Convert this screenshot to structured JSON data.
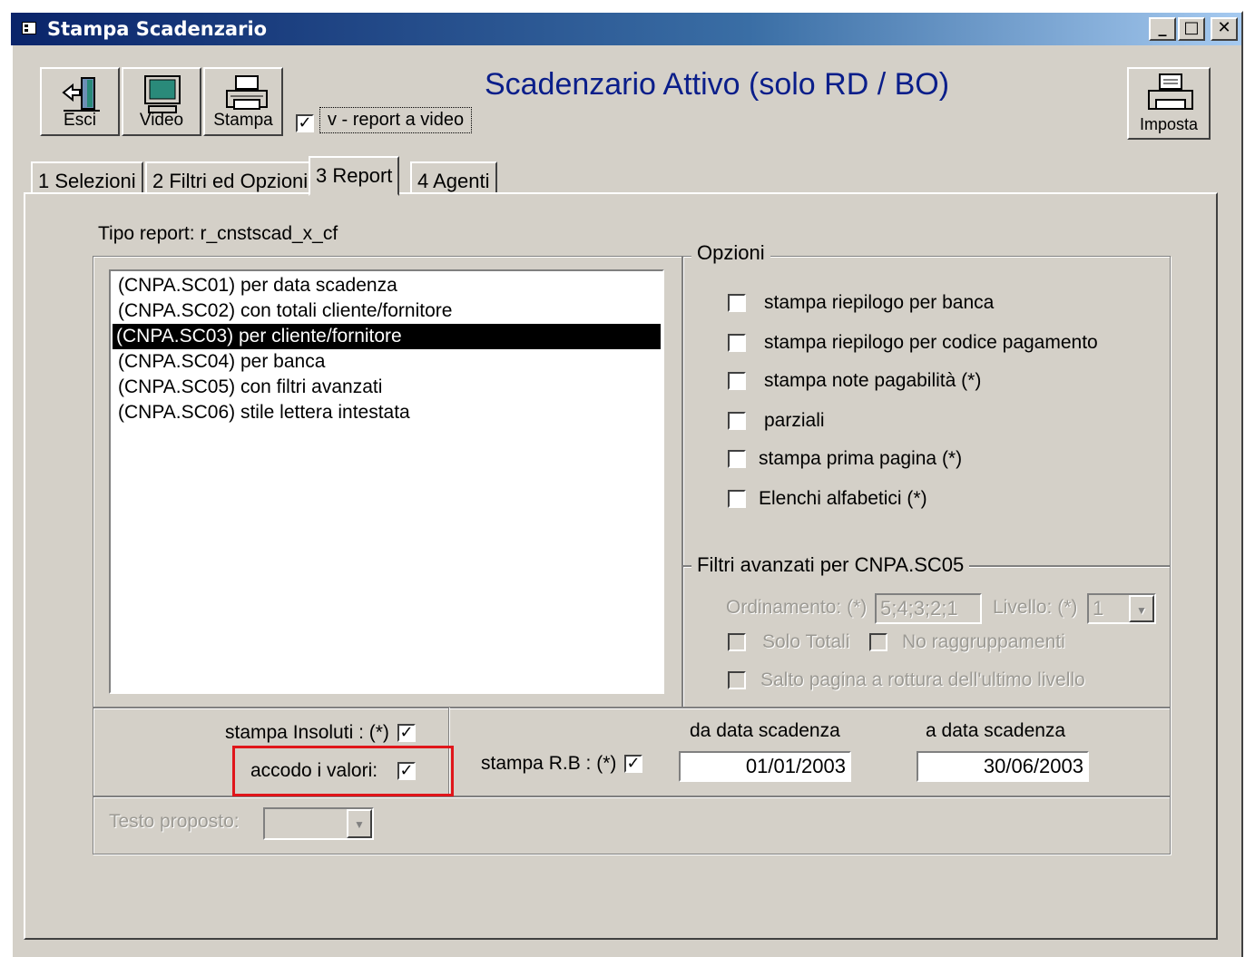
{
  "window": {
    "title": "Stampa Scadenzario",
    "controls": [
      "minimize",
      "maximize",
      "close"
    ]
  },
  "toolbar": {
    "esci_label": "Esci",
    "video_label": "Video",
    "stampa_label": "Stampa",
    "imposta_label": "Imposta",
    "report_video_label": "v - report a video",
    "report_video_checked": true
  },
  "heading": "Scadenzario Attivo (solo RD / BO)",
  "tabs": [
    {
      "label": "1 Selezioni",
      "active": false
    },
    {
      "label": "2 Filtri ed Opzioni",
      "active": false
    },
    {
      "label": "3 Report",
      "active": true
    },
    {
      "label": "4 Agenti",
      "active": false
    }
  ],
  "report": {
    "tipo_label": "Tipo report:",
    "tipo_value": "r_cnstscad_x_cf",
    "items": [
      "(CNPA.SC01) per data scadenza",
      "(CNPA.SC02) con totali cliente/fornitore",
      "(CNPA.SC03) per cliente/fornitore",
      "(CNPA.SC04) per banca",
      "(CNPA.SC05) con filtri avanzati",
      "(CNPA.SC06) stile lettera intestata"
    ],
    "selected_index": 2
  },
  "opzioni": {
    "legend": "Opzioni",
    "items": [
      {
        "label": "stampa riepilogo per banca",
        "checked": false
      },
      {
        "label": "stampa riepilogo per codice pagamento",
        "checked": false
      },
      {
        "label": "stampa note pagabilità (*)",
        "checked": false
      },
      {
        "label": "parziali",
        "checked": false
      },
      {
        "label": "stampa prima pagina (*)",
        "checked": false
      },
      {
        "label": "Elenchi alfabetici (*)",
        "checked": false
      }
    ]
  },
  "filtri": {
    "legend": "Filtri avanzati per CNPA.SC05",
    "ordinamento_label": "Ordinamento: (*)",
    "ordinamento_value": "5;4;3;2;1",
    "livello_label": "Livello: (*)",
    "livello_value": "1",
    "solo_totali_label": "Solo Totali",
    "no_raggruppamenti_label": "No raggruppamenti",
    "salto_pagina_label": "Salto pagina a rottura dell'ultimo livello"
  },
  "bottom": {
    "insoluti_label": "stampa Insoluti : (*)",
    "insoluti_checked": true,
    "accodo_label": "accodo i valori:",
    "accodo_checked": true,
    "rb_label": "stampa R.B : (*)",
    "rb_checked": true,
    "da_data_label": "da data scadenza",
    "da_data_value": "01/01/2003",
    "a_data_label": "a data scadenza",
    "a_data_value": "30/06/2003",
    "testo_label": "Testo proposto:",
    "testo_value": ""
  },
  "colors": {
    "highlight_box": "#e0161b",
    "heading": "#0a1e8a",
    "titlebar": "#0a246a"
  }
}
